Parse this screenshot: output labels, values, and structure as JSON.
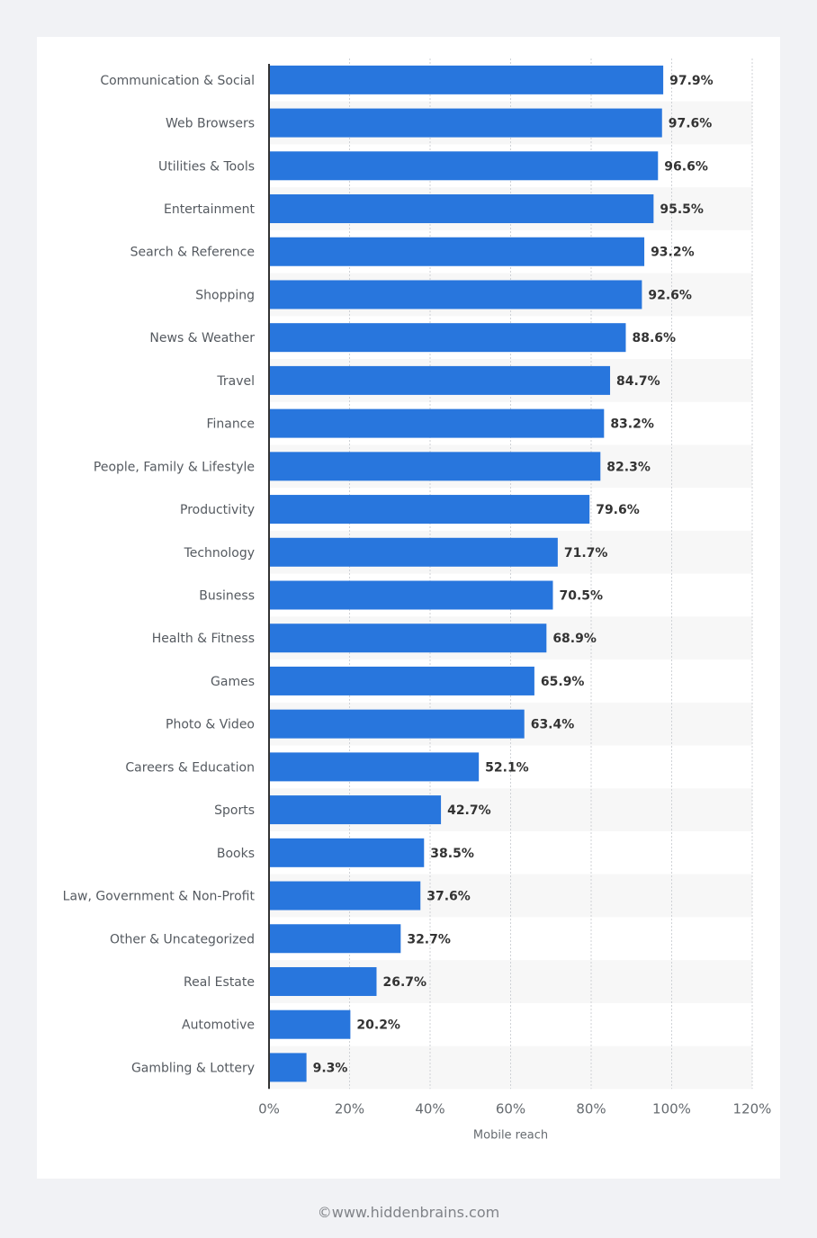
{
  "chart_data": {
    "type": "bar",
    "orientation": "horizontal",
    "title": "",
    "xlabel": "Mobile reach",
    "ylabel": "",
    "xlim": [
      0,
      120
    ],
    "grid": true,
    "legend": "none",
    "bar_color": "#2876dd",
    "x_ticks": [
      "0%",
      "20%",
      "40%",
      "60%",
      "80%",
      "100%",
      "120%"
    ],
    "x_tick_values": [
      0,
      20,
      40,
      60,
      80,
      100,
      120
    ],
    "categories": [
      "Communication & Social",
      "Web Browsers",
      "Utilities & Tools",
      "Entertainment",
      "Search & Reference",
      "Shopping",
      "News & Weather",
      "Travel",
      "Finance",
      "People, Family & Lifestyle",
      "Productivity",
      "Technology",
      "Business",
      "Health & Fitness",
      "Games",
      "Photo & Video",
      "Careers & Education",
      "Sports",
      "Books",
      "Law, Government & Non-Profit",
      "Other & Uncategorized",
      "Real Estate",
      "Automotive",
      "Gambling & Lottery"
    ],
    "values": [
      97.9,
      97.6,
      96.6,
      95.5,
      93.2,
      92.6,
      88.6,
      84.7,
      83.2,
      82.3,
      79.6,
      71.7,
      70.5,
      68.9,
      65.9,
      63.4,
      52.1,
      42.7,
      38.5,
      37.6,
      32.7,
      26.7,
      20.2,
      9.3
    ],
    "value_labels": [
      "97.9%",
      "97.6%",
      "96.6%",
      "95.5%",
      "93.2%",
      "92.6%",
      "88.6%",
      "84.7%",
      "83.2%",
      "82.3%",
      "79.6%",
      "71.7%",
      "70.5%",
      "68.9%",
      "65.9%",
      "63.4%",
      "52.1%",
      "42.7%",
      "38.5%",
      "37.6%",
      "32.7%",
      "26.7%",
      "20.2%",
      "9.3%"
    ]
  },
  "footer": {
    "credit": "©www.hiddenbrains.com"
  }
}
